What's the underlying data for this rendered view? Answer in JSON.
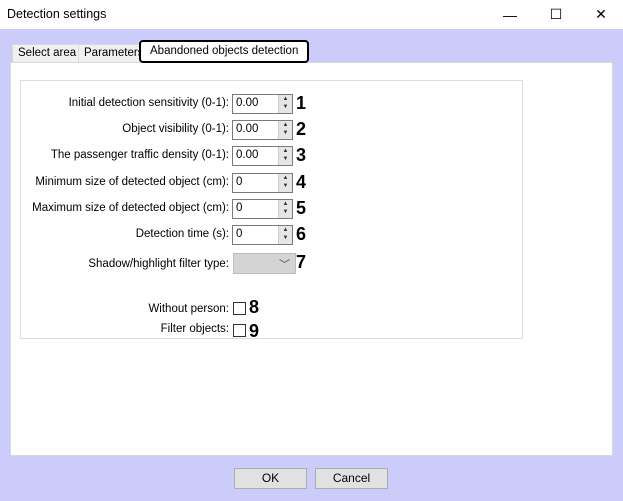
{
  "window": {
    "title": "Detection settings",
    "minimize": "—",
    "maximize": "☐",
    "close": "✕"
  },
  "tabs": [
    {
      "label": "Select area"
    },
    {
      "label": "Parameters"
    },
    {
      "label": "Abandoned objects detection"
    }
  ],
  "fields": [
    {
      "label": "Initial detection sensitivity (0-1):",
      "value": "0.00",
      "marker": "1"
    },
    {
      "label": "Object visibility (0-1):",
      "value": "0.00",
      "marker": "2"
    },
    {
      "label": "The passenger traffic density (0-1):",
      "value": "0.00",
      "marker": "3"
    },
    {
      "label": "Minimum size of detected object (cm):",
      "value": "0",
      "marker": "4"
    },
    {
      "label": "Maximum size of detected object (cm):",
      "value": "0",
      "marker": "5"
    },
    {
      "label": "Detection time (s):",
      "value": "0",
      "marker": "6"
    }
  ],
  "combo": {
    "label": "Shadow/highlight filter type:",
    "value": "",
    "marker": "7"
  },
  "checkboxes": [
    {
      "label": "Without person:",
      "marker": "8",
      "checked": false
    },
    {
      "label": "Filter objects:",
      "marker": "9",
      "checked": false
    }
  ],
  "buttons": {
    "ok": "OK",
    "cancel": "Cancel"
  }
}
